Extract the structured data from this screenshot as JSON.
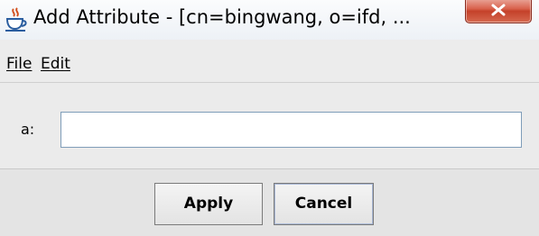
{
  "window": {
    "title": "Add Attribute - [cn=bingwang, o=ifd, ...",
    "icon": "java-cup-icon"
  },
  "menu": {
    "items": [
      {
        "label": "File",
        "mnemonic": "F"
      },
      {
        "label": "Edit",
        "mnemonic": "E"
      }
    ]
  },
  "form": {
    "label": "a:",
    "value": ""
  },
  "buttons": {
    "apply_label": "Apply",
    "cancel_label": "Cancel"
  },
  "colors": {
    "close_button": "#d9624d",
    "input_border": "#7f9db9",
    "background": "#ebebeb"
  }
}
